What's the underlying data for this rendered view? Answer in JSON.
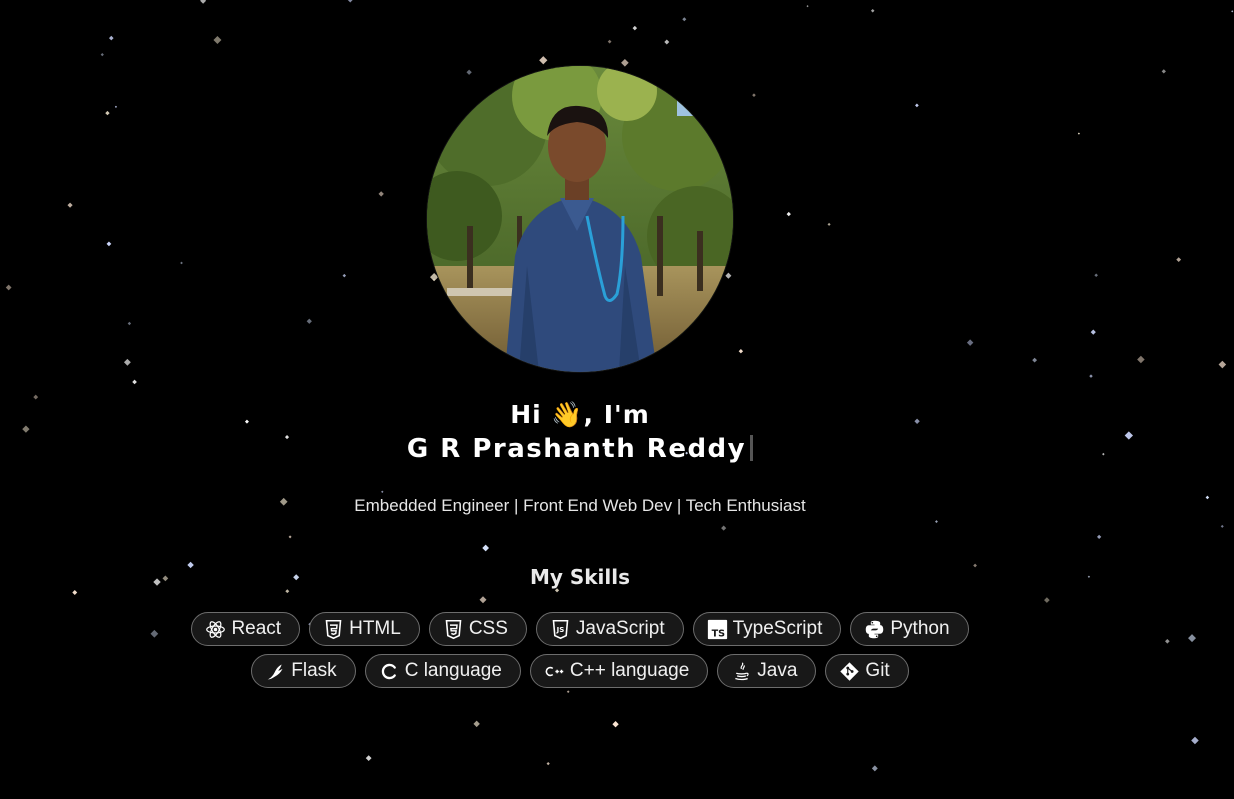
{
  "hero": {
    "photo_alt": "Profile photo",
    "greeting": "Hi 👋, I'm",
    "name": "G R Prashanth Reddy",
    "tagline": "Embedded Engineer | Front End Web Dev | Tech Enthusiast"
  },
  "skills": {
    "title": "My Skills",
    "items": [
      {
        "label": "React",
        "icon": "react-icon"
      },
      {
        "label": "HTML",
        "icon": "html5-icon"
      },
      {
        "label": "CSS",
        "icon": "css3-icon"
      },
      {
        "label": "JavaScript",
        "icon": "javascript-icon"
      },
      {
        "label": "TypeScript",
        "icon": "typescript-icon"
      },
      {
        "label": "Python",
        "icon": "python-icon"
      },
      {
        "label": "Flask",
        "icon": "flask-icon"
      },
      {
        "label": "C language",
        "icon": "c-icon"
      },
      {
        "label": "C++ language",
        "icon": "cplusplus-icon"
      },
      {
        "label": "Java",
        "icon": "java-icon"
      },
      {
        "label": "Git",
        "icon": "git-icon"
      }
    ]
  },
  "colors": {
    "background": "#000000",
    "text": "#ffffff",
    "chip_border": "#6d6d6d",
    "chip_bg": "#181818"
  }
}
